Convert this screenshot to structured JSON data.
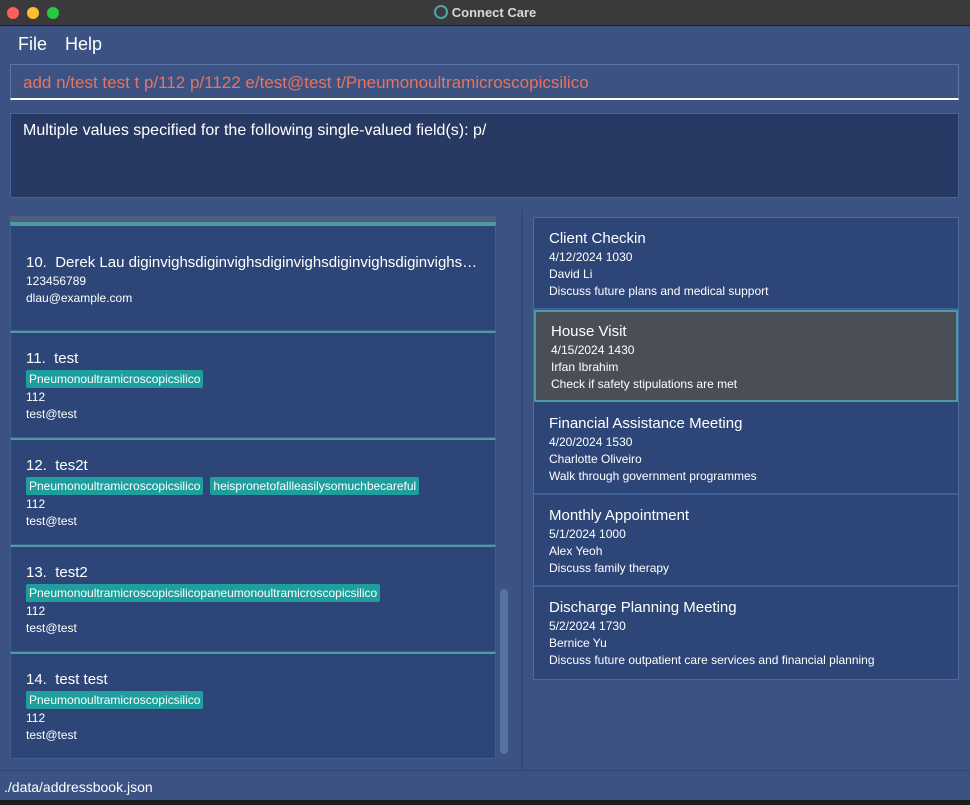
{
  "window": {
    "title": "Connect Care",
    "icon": "app-logo-icon"
  },
  "menu": {
    "file": "File",
    "help": "Help"
  },
  "command": {
    "value": "add n/test test t p/112 p/1122 e/test@test t/Pneumonoultramicroscopicsilico",
    "error_color": "#e8735e"
  },
  "result": {
    "message": "Multiple values specified for the following single-valued field(s): p/"
  },
  "persons": [
    {
      "index": "10.",
      "name": "Derek Lau diginvighsdiginvighsdiginvighsdiginvighsdiginvighs…",
      "tags": [],
      "phone": "123456789",
      "email": "dlau@example.com"
    },
    {
      "index": "11.",
      "name": "test",
      "tags": [
        "Pneumonoultramicroscopicsilico"
      ],
      "phone": "112",
      "email": "test@test"
    },
    {
      "index": "12.",
      "name": "tes2t",
      "tags": [
        "Pneumonoultramicroscopicsilico",
        "heispronetofallleasilysomuchbecareful"
      ],
      "phone": "112",
      "email": "test@test"
    },
    {
      "index": "13.",
      "name": "test2",
      "tags": [
        "Pneumonoultramicroscopicsilicopaneumonoultramicroscopicsilico"
      ],
      "phone": "112",
      "email": "test@test"
    },
    {
      "index": "14.",
      "name": "test test",
      "tags": [
        "Pneumonoultramicroscopicsilico"
      ],
      "phone": "112",
      "email": "test@test"
    }
  ],
  "appointments": [
    {
      "title": "Client Checkin",
      "datetime": "4/12/2024 1030",
      "person": "David Li",
      "description": "Discuss future plans and medical support",
      "selected": false
    },
    {
      "title": "House Visit",
      "datetime": "4/15/2024 1430",
      "person": "Irfan Ibrahim",
      "description": "Check if safety stipulations are met",
      "selected": true
    },
    {
      "title": "Financial Assistance Meeting",
      "datetime": "4/20/2024 1530",
      "person": "Charlotte Oliveiro",
      "description": "Walk through government programmes",
      "selected": false
    },
    {
      "title": "Monthly Appointment",
      "datetime": "5/1/2024 1000",
      "person": "Alex Yeoh",
      "description": "Discuss family therapy",
      "selected": false
    },
    {
      "title": "Discharge Planning Meeting",
      "datetime": "5/2/2024 1730",
      "person": "Bernice Yu",
      "description": "Discuss future outpatient care services and financial planning",
      "selected": false
    }
  ],
  "status": {
    "path": "./data/addressbook.json"
  },
  "colors": {
    "background": "#3b5283",
    "card": "#2e4677",
    "tag": "#1e9e9d",
    "selected_card": "#4a4f57",
    "accent_border": "#4d9aa5"
  }
}
